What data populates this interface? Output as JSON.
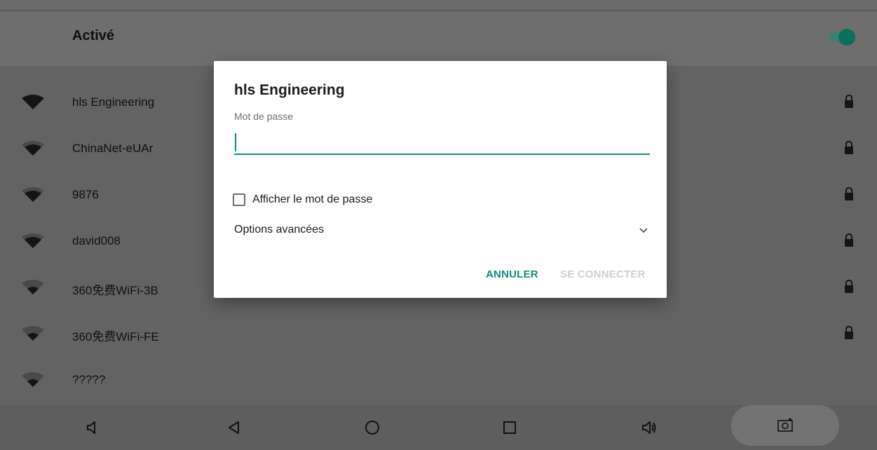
{
  "wifi_toggle": {
    "label": "Activé",
    "on": true
  },
  "networks": [
    {
      "name": "hls Engineering",
      "signal": 4,
      "secured": true
    },
    {
      "name": "ChinaNet-eUAr",
      "signal": 3,
      "secured": true
    },
    {
      "name": "9876",
      "signal": 3,
      "secured": true
    },
    {
      "name": "david008",
      "signal": 3,
      "secured": true
    },
    {
      "name": "360免费WiFi-3B",
      "signal": 2,
      "secured": true
    },
    {
      "name": "360免费WiFi-FE",
      "signal": 2,
      "secured": true
    },
    {
      "name": "?????",
      "signal": 2,
      "secured": false
    }
  ],
  "dialog": {
    "title": "hls Engineering",
    "password_label": "Mot de passe",
    "password_value": "",
    "show_password_label": "Afficher le mot de passe",
    "show_password_checked": false,
    "advanced_label": "Options avancées",
    "cancel_label": "ANNULER",
    "connect_label": "SE CONNECTER"
  },
  "navbar": {
    "icons": [
      "volume-down-icon",
      "back-icon",
      "home-icon",
      "recents-icon",
      "volume-up-icon",
      "screenshot-icon"
    ]
  },
  "colors": {
    "accent": "#0f8d7e",
    "disabled": "#cfcfcf"
  }
}
